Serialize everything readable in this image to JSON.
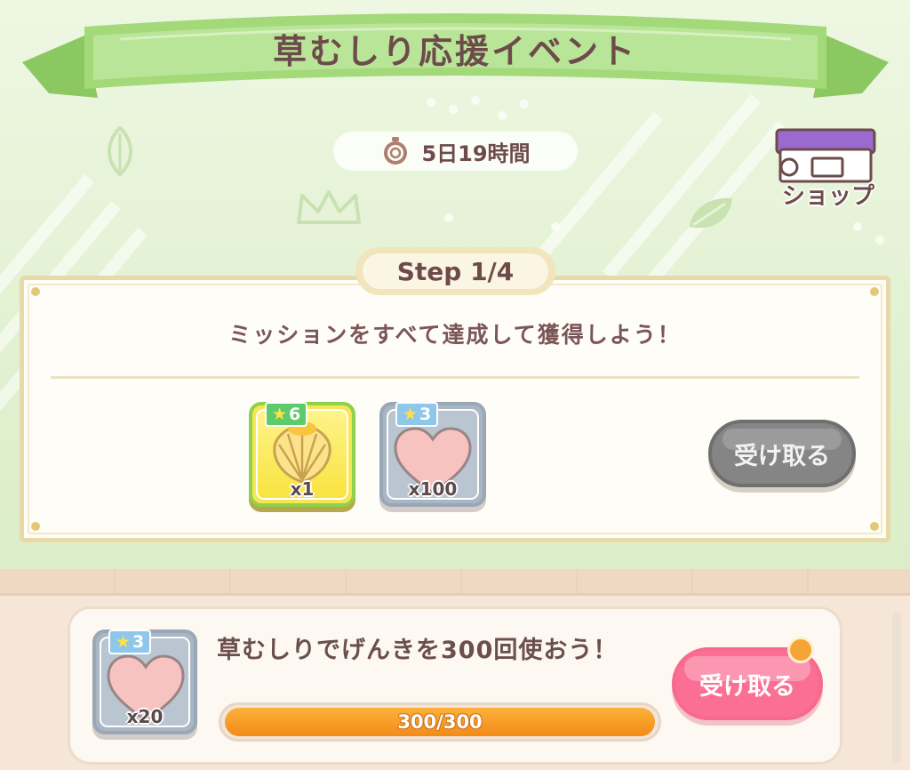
{
  "event": {
    "title": "草むしり応援イベント",
    "timer": "5日19時間",
    "timer_icon": "stopwatch-icon"
  },
  "shop": {
    "label": "ショップ",
    "icon": "shop-icon"
  },
  "step": {
    "label": "Step 1/4",
    "instruction": "ミッションをすべて達成して獲得しよう！",
    "rewards": [
      {
        "icon": "shell-icon",
        "stars": "6",
        "quantity": "x1"
      },
      {
        "icon": "heart-icon",
        "stars": "3",
        "quantity": "x100"
      }
    ],
    "claim_button": {
      "label": "受け取る",
      "enabled": false
    }
  },
  "missions": [
    {
      "reward_icon": "heart-icon",
      "reward_stars": "3",
      "reward_quantity": "x20",
      "description": "草むしりでげんきを300回使おう！",
      "progress_text": "300/300",
      "progress_fraction": 1.0,
      "claim_label": "受け取る",
      "has_notification": true
    }
  ],
  "colors": {
    "accent_green": "#8cc862",
    "title_brown": "#6e4b4b",
    "claim_pink": "#fb6f94",
    "progress_orange": "#f48a18",
    "disabled_gray": "#858585"
  }
}
